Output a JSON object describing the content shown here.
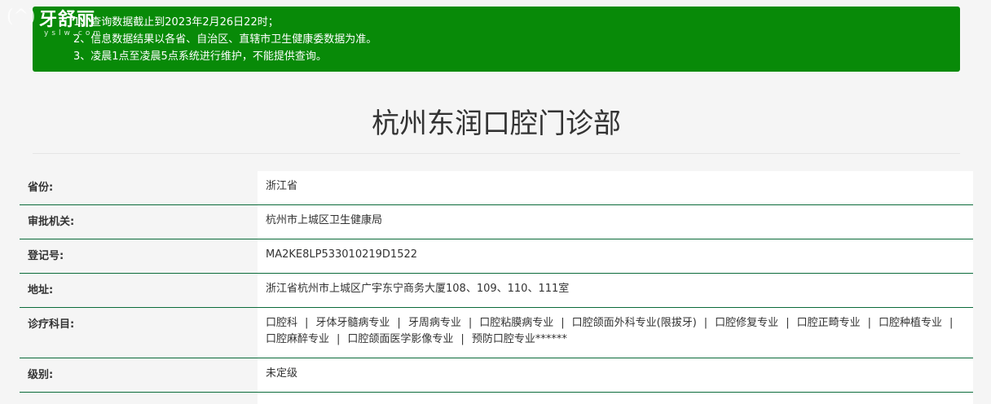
{
  "logo": {
    "name": "牙舒丽",
    "subtext": "yslw.com"
  },
  "notice": {
    "lines": [
      "1、查询数据截止到2023年2月26日22时；",
      "2、信息数据结果以各省、自治区、直辖市卫生健康委数据为准。",
      "3、凌晨1点至凌晨5点系统进行维护，不能提供查询。"
    ],
    "bg_color": "#088a08"
  },
  "page": {
    "title": "杭州东润口腔门诊部"
  },
  "info": {
    "rows": [
      {
        "label": "省份:",
        "value": "浙江省"
      },
      {
        "label": "审批机关:",
        "value": "杭州市上城区卫生健康局"
      },
      {
        "label": "登记号:",
        "value": "MA2KE8LP533010219D1522"
      },
      {
        "label": "地址:",
        "value": "浙江省杭州市上城区广宇东宁商务大厦108、109、110、111室"
      },
      {
        "label": "诊疗科目:",
        "subjects": [
          "口腔科",
          "牙体牙髓病专业",
          "牙周病专业",
          "口腔粘膜病专业",
          "口腔颌面外科专业(限拔牙)",
          "口腔修复专业",
          "口腔正畸专业",
          "口腔种植专业",
          "口腔麻醉专业",
          "口腔颌面医学影像专业",
          "预防口腔专业******"
        ]
      },
      {
        "label": "级别:",
        "value": "未定级"
      }
    ],
    "row_border_color": "#0b6b3a"
  }
}
